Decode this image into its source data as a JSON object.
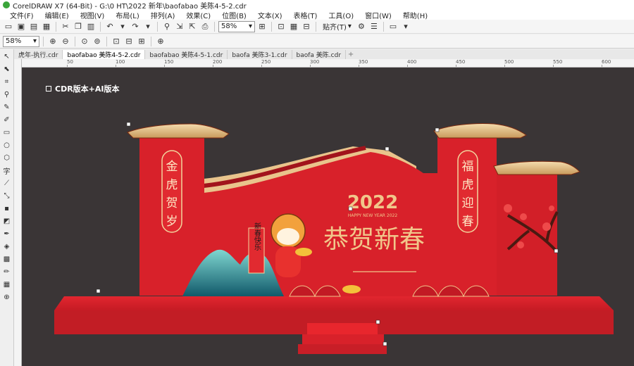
{
  "window": {
    "title": "CorelDRAW X7 (64-Bit) - G:\\0 HT\\2022 新年\\baofabao 美陈4-5-2.cdr"
  },
  "menu": [
    "文件(F)",
    "编辑(E)",
    "视图(V)",
    "布局(L)",
    "排列(A)",
    "效果(C)",
    "位图(B)",
    "文本(X)",
    "表格(T)",
    "工具(O)",
    "窗口(W)",
    "帮助(H)"
  ],
  "toolbar": {
    "zoom_value": "58%",
    "snap_label": "贴齐(T)"
  },
  "propbar": {
    "zoom_value": "58%"
  },
  "tabs": [
    "虎年-执行.cdr",
    "baofabao 美陈4-5-2.cdr",
    "baofabao 美陈4-5-1.cdr",
    "baofa 美陈3-1.cdr",
    "baofa 美陈.cdr"
  ],
  "active_tab_index": 1,
  "ruler_labels": [
    "50",
    "100",
    "150",
    "200",
    "250",
    "300",
    "350",
    "400",
    "450",
    "500",
    "550",
    "600"
  ],
  "canvas_note": "CDR版本+AI版本",
  "artwork": {
    "left_column_text": [
      "金",
      "虎",
      "贺",
      "岁"
    ],
    "right_column_text": [
      "福",
      "虎",
      "迎",
      "春"
    ],
    "year": "2022",
    "year_subtitle": "HAPPY NEW YEAR 2022",
    "headline": "恭贺新春",
    "scroll_text": "新春快乐"
  },
  "colors": {
    "canvas_bg": "#3a3536",
    "stage_red": "#d8212a",
    "gold": "#e9c48c",
    "dark_red": "#a2141c"
  }
}
